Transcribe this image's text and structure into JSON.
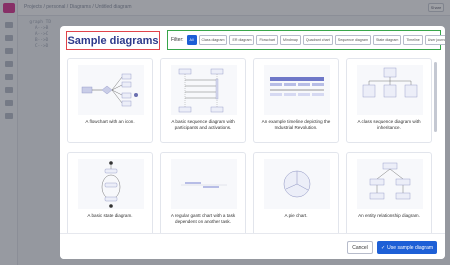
{
  "app": {
    "breadcrumb": "Projects  /  personal  /  Diagrams  /  Untitled diagram",
    "share_label": "Share",
    "code_lines": [
      "  graph TD",
      "    A-->B",
      "    A-->C",
      "    B-->D",
      "    C-->D",
      "  "
    ]
  },
  "modal": {
    "title": "Sample diagrams",
    "filter_label": "Filter:",
    "filters": [
      "All",
      "Class diagram",
      "ER diagram",
      "Flowchart",
      "Mindmap",
      "Quadrant chart",
      "Sequence diagram",
      "State diagram",
      "Timeline",
      "User journey"
    ],
    "active_filter": "All",
    "cards": [
      {
        "caption": "A flowchart with an icon.",
        "kind": "flowchart"
      },
      {
        "caption": "A basic sequence diagram with participants and activations.",
        "kind": "sequence"
      },
      {
        "caption": "An example timeline depicting the Industrial Revolution.",
        "kind": "timeline"
      },
      {
        "caption": "A class sequence diagram with inheritance.",
        "kind": "class"
      },
      {
        "caption": "A basic state diagram.",
        "kind": "state"
      },
      {
        "caption": "A regular gantt chart with a task dependent on another task.",
        "kind": "gantt"
      },
      {
        "caption": "A pie chart.",
        "kind": "pie"
      },
      {
        "caption": "An entity relationship diagram.",
        "kind": "er"
      }
    ],
    "cancel_label": "Cancel",
    "use_label": "Use sample diagram",
    "colors": {
      "primary": "#1d5fd6",
      "title_border": "#e0434a",
      "filter_border": "#37a64a",
      "title_text": "#2d3a8c"
    }
  }
}
